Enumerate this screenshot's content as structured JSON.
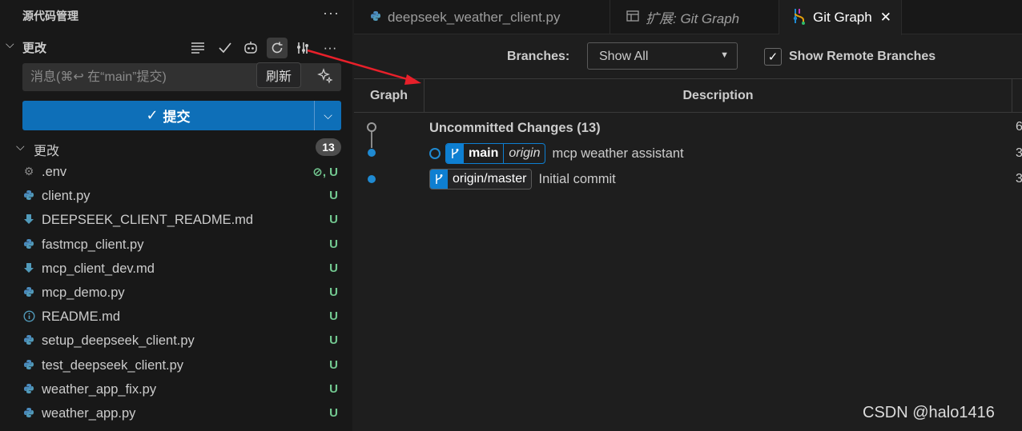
{
  "scm": {
    "title": "源代码管理",
    "more": "···",
    "section_label": "更改",
    "tooltip": "刷新",
    "message_placeholder": "消息(⌘↩ 在“main”提交)",
    "commit_label": "提交",
    "changes_label": "更改",
    "changes_count": "13",
    "files": [
      {
        "name": ".env",
        "status": "⊘, U",
        "icon": "gear-icon"
      },
      {
        "name": "client.py",
        "status": "U",
        "icon": "python-icon"
      },
      {
        "name": "DEEPSEEK_CLIENT_README.md",
        "status": "U",
        "icon": "markdown-icon"
      },
      {
        "name": "fastmcp_client.py",
        "status": "U",
        "icon": "python-icon"
      },
      {
        "name": "mcp_client_dev.md",
        "status": "U",
        "icon": "markdown-icon"
      },
      {
        "name": "mcp_demo.py",
        "status": "U",
        "icon": "python-icon"
      },
      {
        "name": "README.md",
        "status": "U",
        "icon": "info-icon"
      },
      {
        "name": "setup_deepseek_client.py",
        "status": "U",
        "icon": "python-icon"
      },
      {
        "name": "test_deepseek_client.py",
        "status": "U",
        "icon": "python-icon"
      },
      {
        "name": "weather_app_fix.py",
        "status": "U",
        "icon": "python-icon"
      },
      {
        "name": "weather_app.py",
        "status": "U",
        "icon": "python-icon"
      }
    ]
  },
  "tabs": [
    {
      "label": "deepseek_weather_client.py",
      "icon": "python-icon"
    },
    {
      "label": "扩展: Git Graph",
      "icon": "extension-preview-icon"
    },
    {
      "label": "Git Graph",
      "icon": "git-graph-icon",
      "close": "✕"
    }
  ],
  "gitgraph": {
    "branches_label": "Branches:",
    "branches_value": "Show All",
    "remote_label": "Show Remote Branches",
    "col_graph": "Graph",
    "col_desc": "Description",
    "rows": [
      {
        "text": "Uncommitted Changes (13)",
        "trunc": "6"
      },
      {
        "branch": "main",
        "remote": "origin",
        "text": "mcp weather assistant",
        "trunc": "3"
      },
      {
        "branch": "origin/master",
        "text": "Initial commit",
        "trunc": "3"
      }
    ]
  },
  "watermark": "CSDN @halo1416",
  "colors": {
    "accent": "#0e6fb8",
    "untracked": "#73c991",
    "graph_blue": "#1f8ad2",
    "annotation_arrow": "#e8202a"
  }
}
